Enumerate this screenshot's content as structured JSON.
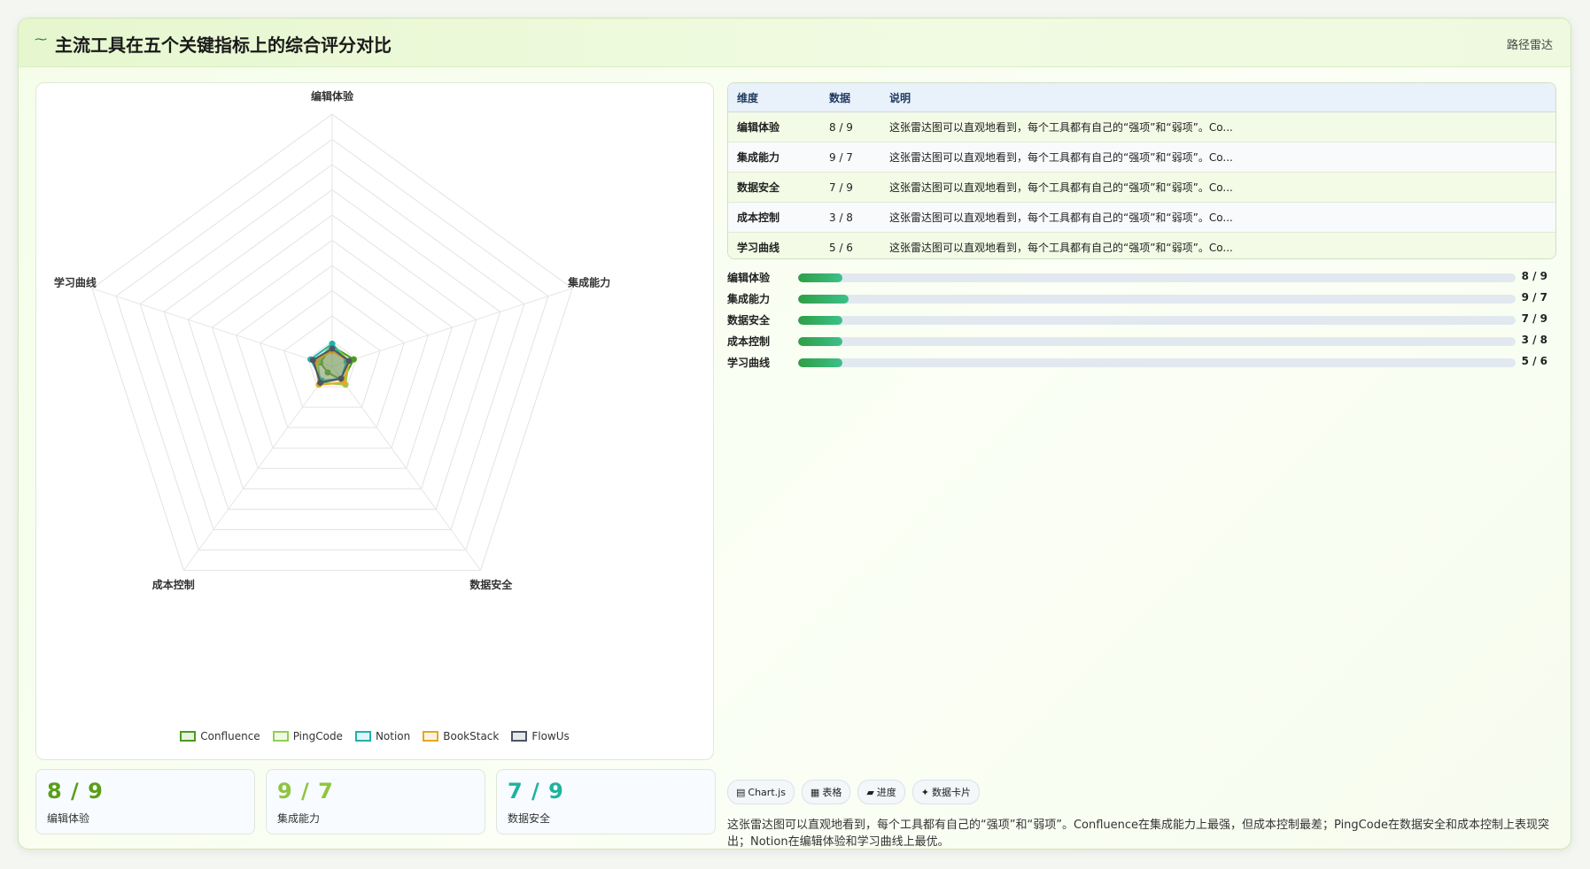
{
  "header": {
    "icon": "wave-icon",
    "title": "主流工具在五个关键指标上的综合评分对比",
    "subtitle": "路径雷达"
  },
  "chart_data": {
    "type": "radar",
    "axes": [
      "编辑体验",
      "集成能力",
      "数据安全",
      "成本控制",
      "学习曲线"
    ],
    "r_max": 100,
    "grid_levels": 10,
    "series": [
      {
        "name": "Confluence",
        "values": [
          8,
          9,
          7,
          3,
          5
        ],
        "color": "#4d9a1e"
      },
      {
        "name": "PingCode",
        "values": [
          9,
          7,
          9,
          8,
          6
        ],
        "color": "#8fd14f"
      },
      {
        "name": "Notion",
        "values": [
          9,
          6,
          6,
          7,
          9
        ],
        "color": "#20b2aa"
      },
      {
        "name": "BookStack",
        "values": [
          6,
          7,
          8,
          9,
          7
        ],
        "color": "#e5a823"
      },
      {
        "name": "FlowUs",
        "values": [
          7,
          7,
          6,
          8,
          8
        ],
        "color": "#4b5563"
      }
    ]
  },
  "table": {
    "headers": [
      "维度",
      "数据",
      "说明"
    ],
    "rows": [
      {
        "dim": "编辑体验",
        "data": "8 / 9",
        "desc": "这张雷达图可以直观地看到，每个工具都有自己的“强项”和“弱项”。Co..."
      },
      {
        "dim": "集成能力",
        "data": "9 / 7",
        "desc": "这张雷达图可以直观地看到，每个工具都有自己的“强项”和“弱项”。Co..."
      },
      {
        "dim": "数据安全",
        "data": "7 / 9",
        "desc": "这张雷达图可以直观地看到，每个工具都有自己的“强项”和“弱项”。Co..."
      },
      {
        "dim": "成本控制",
        "data": "3 / 8",
        "desc": "这张雷达图可以直观地看到，每个工具都有自己的“强项”和“弱项”。Co..."
      },
      {
        "dim": "学习曲线",
        "data": "5 / 6",
        "desc": "这张雷达图可以直观地看到，每个工具都有自己的“强项”和“弱项”。Co..."
      }
    ]
  },
  "progress": [
    {
      "label": "编辑体验",
      "value": "8 / 9",
      "fraction": 0.062
    },
    {
      "label": "集成能力",
      "value": "9 / 7",
      "fraction": 0.07
    },
    {
      "label": "数据安全",
      "value": "7 / 9",
      "fraction": 0.062
    },
    {
      "label": "成本控制",
      "value": "3 / 8",
      "fraction": 0.062
    },
    {
      "label": "学习曲线",
      "value": "5 / 6",
      "fraction": 0.062
    }
  ],
  "stats": [
    {
      "value": "8 / 9",
      "label": "编辑体验",
      "color": "#5a9e1a"
    },
    {
      "value": "9 / 7",
      "label": "集成能力",
      "color": "#8cc63f"
    },
    {
      "value": "7 / 9",
      "label": "数据安全",
      "color": "#1fb2a0"
    }
  ],
  "chips": [
    {
      "icon": "chart-icon",
      "glyph": "▤",
      "label": "Chart.js"
    },
    {
      "icon": "table-icon",
      "glyph": "▦",
      "label": "表格"
    },
    {
      "icon": "progress-icon",
      "glyph": "▰",
      "label": "进度"
    },
    {
      "icon": "card-icon",
      "glyph": "✦",
      "label": "数据卡片"
    }
  ],
  "note": "这张雷达图可以直观地看到，每个工具都有自己的“强项”和“弱项”。Confluence在集成能力上最强，但成本控制最差；PingCode在数据安全和成本控制上表现突出；Notion在编辑体验和学习曲线上最优。"
}
